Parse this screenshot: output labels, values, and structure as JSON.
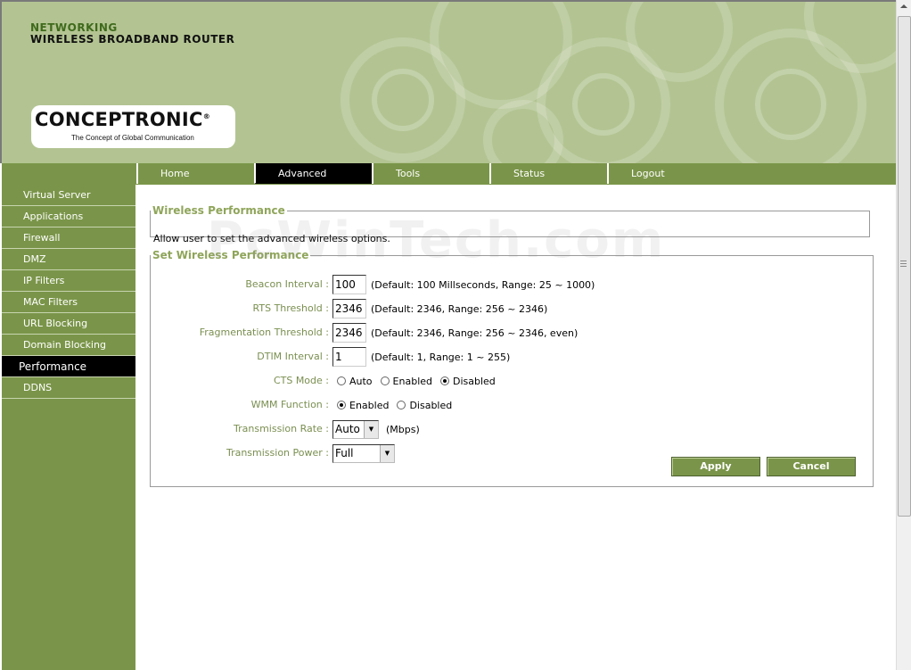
{
  "header": {
    "brand_top": "NETWORKING",
    "brand_sub": "WIRELESS BROADBAND ROUTER",
    "logo_name": "CONCEPTRONIC",
    "logo_mark": "®",
    "logo_tagline": "The Concept of Global Communication"
  },
  "nav": {
    "tabs": [
      {
        "label": "Home",
        "active": false
      },
      {
        "label": "Advanced",
        "active": true
      },
      {
        "label": "Tools",
        "active": false
      },
      {
        "label": "Status",
        "active": false
      },
      {
        "label": "Logout",
        "active": false
      }
    ]
  },
  "sidebar": {
    "items": [
      {
        "label": "Virtual Server"
      },
      {
        "label": "Applications"
      },
      {
        "label": "Firewall"
      },
      {
        "label": "DMZ"
      },
      {
        "label": "IP Filters"
      },
      {
        "label": "MAC Filters"
      },
      {
        "label": "URL Blocking"
      },
      {
        "label": "Domain Blocking"
      },
      {
        "label": "Performance",
        "active": true
      },
      {
        "label": "DDNS"
      }
    ]
  },
  "wireless_performance": {
    "title": "Wireless Performance",
    "description": "Allow user to set the advanced wireless options."
  },
  "settings": {
    "title": "Set Wireless Performance",
    "beacon": {
      "label": "Beacon Interval :",
      "value": "100",
      "hint": "(Default: 100 Millseconds, Range: 25 ~ 1000)"
    },
    "rts": {
      "label": "RTS Threshold :",
      "value": "2346",
      "hint": "(Default: 2346, Range: 256 ~ 2346)"
    },
    "frag": {
      "label": "Fragmentation Threshold :",
      "value": "2346",
      "hint": "(Default: 2346, Range: 256 ~ 2346, even)"
    },
    "dtim": {
      "label": "DTIM Interval :",
      "value": "1",
      "hint": "(Default: 1, Range: 1 ~ 255)"
    },
    "cts": {
      "label": "CTS Mode :",
      "options": [
        "Auto",
        "Enabled",
        "Disabled"
      ],
      "selected": "Disabled"
    },
    "wmm": {
      "label": "WMM Function :",
      "options": [
        "Enabled",
        "Disabled"
      ],
      "selected": "Enabled"
    },
    "rate": {
      "label": "Transmission Rate :",
      "value": "Auto",
      "unit": "(Mbps)"
    },
    "power": {
      "label": "Transmission Power :",
      "value": "Full"
    }
  },
  "buttons": {
    "apply": "Apply",
    "cancel": "Cancel"
  },
  "watermark": "PcWinTech.com",
  "colors": {
    "accent": "#7a9549",
    "header_bg": "#b3c492",
    "label": "#7a8f50",
    "legend": "#8fa55a"
  }
}
